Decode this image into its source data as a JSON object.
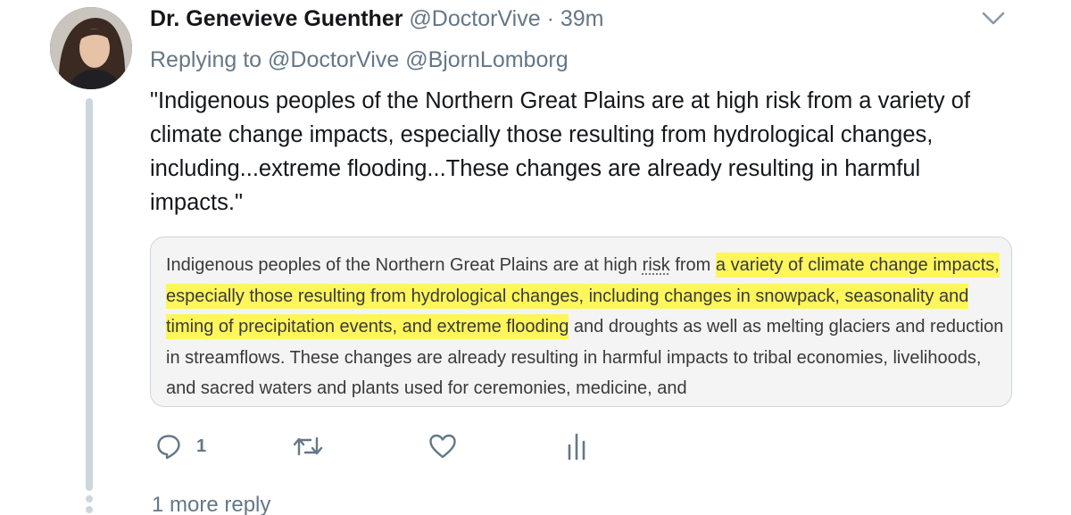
{
  "tweet": {
    "author_name": "Dr. Genevieve Guenther",
    "author_handle": "@DoctorVive",
    "separator": "·",
    "time": "39m",
    "replying_prefix": "Replying to",
    "replying_to": [
      "@DoctorVive",
      "@BjornLomborg"
    ],
    "text": "\"Indigenous peoples of the Northern Great Plains are at high risk from a variety of climate change impacts, especially those resulting from hydrological changes, including...extreme flooding...These changes are already resulting in harmful impacts.\"",
    "quote": {
      "part1": "Indigenous peoples of the Northern Great Plains are at high ",
      "risk_word": "risk",
      "part2": " from ",
      "highlighted": "a variety of climate change impacts, especially those resulting from hydrological changes, including changes in snowpack, seasonality and timing of precipitation events, and extreme flooding",
      "part3": " and droughts as well as melting glaciers and reduction in streamflows. These changes are already resulting in harmful impacts to tribal economies, livelihoods, and sacred waters and plants used for ceremonies, medicine, and"
    },
    "actions": {
      "reply_count": "1",
      "reply_icon": "reply-icon",
      "retweet_icon": "retweet-icon",
      "like_icon": "heart-icon",
      "analytics_icon": "analytics-icon"
    }
  },
  "more_replies": "1 more reply",
  "colors": {
    "text": "#14171a",
    "secondary": "#657786",
    "highlight": "#fef65b",
    "thread_line": "#ccd6dd"
  }
}
